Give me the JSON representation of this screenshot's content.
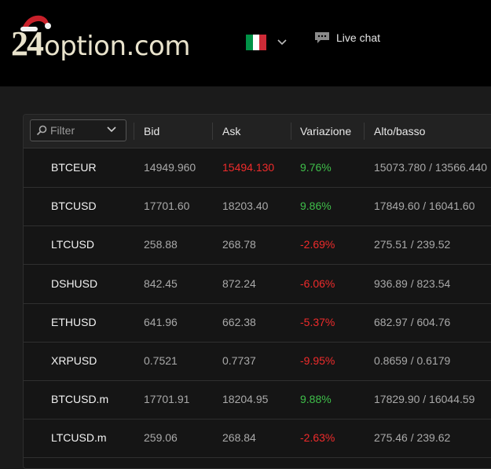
{
  "header": {
    "logo_number": "24",
    "logo_text": "option.com",
    "live_chat_label": "Live chat",
    "flag_colors": [
      "#009246",
      "#ffffff",
      "#ce2b37"
    ]
  },
  "table": {
    "filter_placeholder": "Filter",
    "columns": {
      "bid": "Bid",
      "ask": "Ask",
      "change": "Variazione",
      "high_low": "Alto/basso"
    },
    "rows": [
      {
        "symbol": "BTCEUR",
        "bid": "14949.960",
        "ask": "15494.130",
        "change": "9.76%",
        "high_low": "15073.780 / 13566.440",
        "direction": "up",
        "ask_highlight": true
      },
      {
        "symbol": "BTCUSD",
        "bid": "17701.60",
        "ask": "18203.40",
        "change": "9.86%",
        "high_low": "17849.60 / 16041.60",
        "direction": "up",
        "ask_highlight": false
      },
      {
        "symbol": "LTCUSD",
        "bid": "258.88",
        "ask": "268.78",
        "change": "-2.69%",
        "high_low": "275.51 / 239.52",
        "direction": "down",
        "ask_highlight": false
      },
      {
        "symbol": "DSHUSD",
        "bid": "842.45",
        "ask": "872.24",
        "change": "-6.06%",
        "high_low": "936.89 / 823.54",
        "direction": "down",
        "ask_highlight": false
      },
      {
        "symbol": "ETHUSD",
        "bid": "641.96",
        "ask": "662.38",
        "change": "-5.37%",
        "high_low": "682.97 / 604.76",
        "direction": "down",
        "ask_highlight": false
      },
      {
        "symbol": "XRPUSD",
        "bid": "0.7521",
        "ask": "0.7737",
        "change": "-9.95%",
        "high_low": "0.8659 / 0.6179",
        "direction": "down",
        "ask_highlight": false
      },
      {
        "symbol": "BTCUSD.m",
        "bid": "17701.91",
        "ask": "18204.95",
        "change": "9.88%",
        "high_low": "17829.90 / 16044.59",
        "direction": "up",
        "ask_highlight": false
      },
      {
        "symbol": "LTCUSD.m",
        "bid": "259.06",
        "ask": "268.84",
        "change": "-2.63%",
        "high_low": "275.46 / 239.62",
        "direction": "down",
        "ask_highlight": false
      }
    ]
  },
  "colors": {
    "positive": "#3fbf4a",
    "negative": "#ef2b2b"
  }
}
